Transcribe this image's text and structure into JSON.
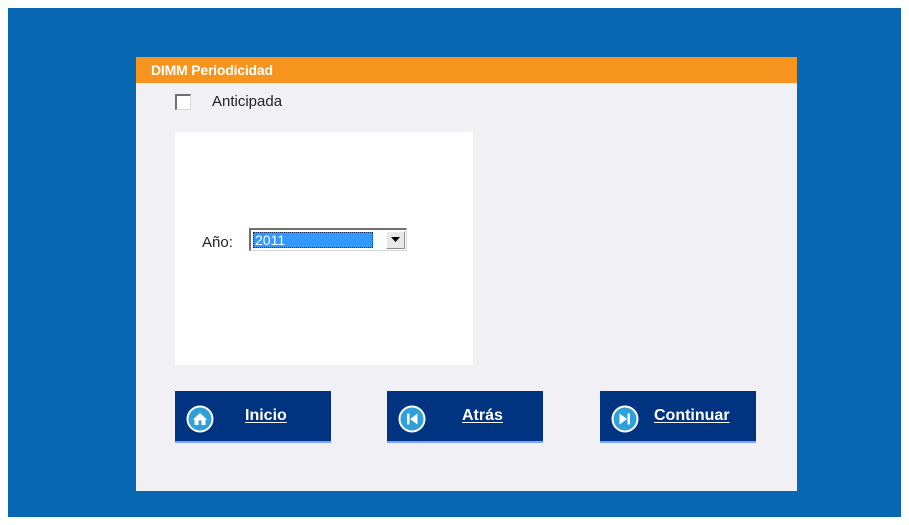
{
  "window": {
    "title": "DIMM Periodicidad"
  },
  "options": {
    "anticipada_label": "Anticipada",
    "anticipada_checked": false
  },
  "year": {
    "label": "Año:",
    "selected_value": "2011"
  },
  "buttons": {
    "inicio": {
      "label": "Inicio",
      "icon": "home-icon"
    },
    "atras": {
      "label": "Atrás",
      "icon": "skip-back-icon"
    },
    "continuar": {
      "label": "Continuar",
      "icon": "skip-forward-icon"
    }
  },
  "colors": {
    "background": "#0867b3",
    "title_bar": "#f7941d",
    "dialog": "#f1f1f5",
    "button": "#003380",
    "selection": "#3399ff"
  }
}
